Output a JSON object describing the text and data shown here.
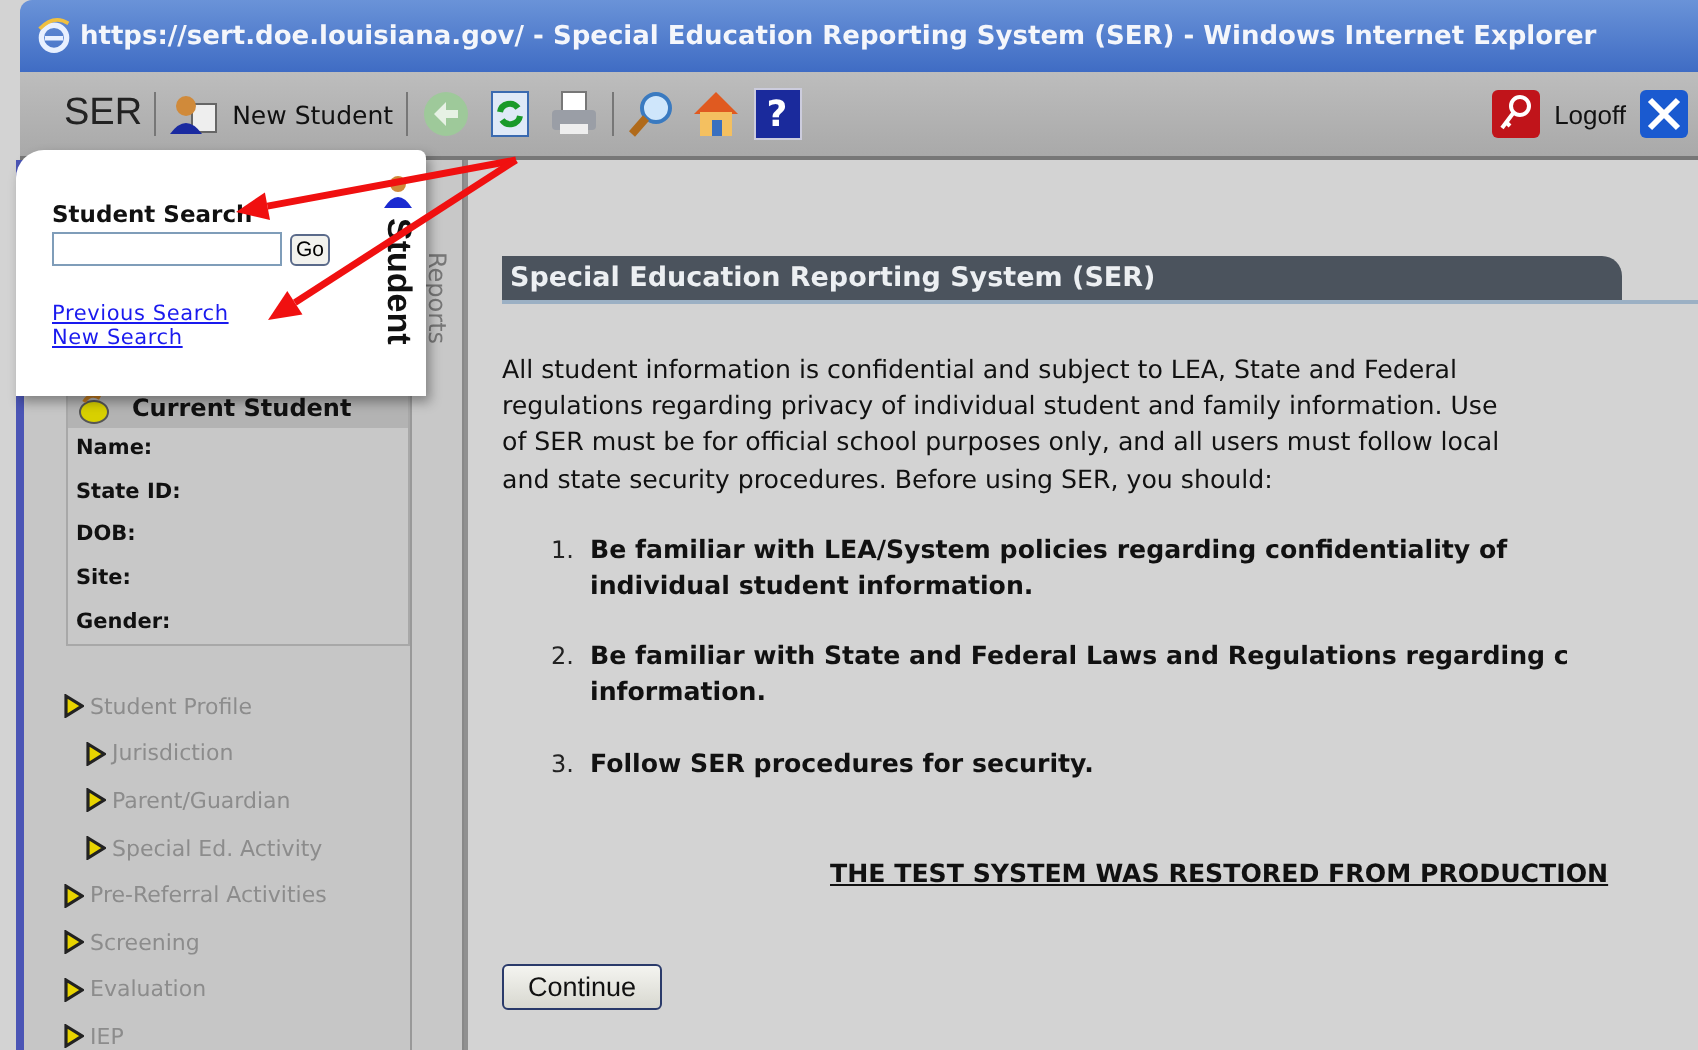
{
  "window": {
    "title": "https://sert.doe.louisiana.gov/ - Special Education Reporting System (SER) - Windows Internet Explorer"
  },
  "toolbar": {
    "logo": "SER",
    "new_student": "New Student",
    "help": "?",
    "logoff": "Logoff"
  },
  "search_flyout": {
    "title": "Student Search",
    "go": "Go",
    "links": [
      "Previous Search",
      "New Search"
    ],
    "tab": "Student"
  },
  "side_tab": "Reports",
  "current_student": {
    "title": "Current Student",
    "fields": [
      "Name:",
      "State ID:",
      "DOB:",
      "Site:",
      "Gender:"
    ]
  },
  "nav": [
    {
      "label": "Student Profile",
      "disabled": true,
      "children": [
        {
          "label": "Jurisdiction",
          "disabled": true
        },
        {
          "label": "Parent/Guardian",
          "disabled": true
        },
        {
          "label": "Special Ed. Activity",
          "disabled": true
        }
      ]
    },
    {
      "label": "Pre-Referral Activities",
      "disabled": true
    },
    {
      "label": "Screening",
      "disabled": true
    },
    {
      "label": "Evaluation",
      "disabled": true
    },
    {
      "label": "IEP",
      "disabled": true
    }
  ],
  "content": {
    "heading": "Special Education Reporting System (SER)",
    "intro_lines": [
      "All student information is confidential and subject to LEA, State and Federal",
      "regulations regarding privacy of individual student and family information. Use",
      "of SER must be for official school purposes only, and all users must follow local",
      "and state security procedures. Before using SER, you should:"
    ],
    "steps": [
      {
        "number": "1.",
        "lines": [
          "Be familiar with LEA/System policies regarding confidentiality of",
          "individual student information."
        ]
      },
      {
        "number": "2.",
        "lines": [
          "Be familiar with State and Federal Laws and Regulations regarding c",
          "information."
        ]
      },
      {
        "number": "3.",
        "lines": [
          "Follow SER procedures for security."
        ]
      }
    ],
    "notice": "THE TEST SYSTEM WAS RESTORED FROM PRODUCTION",
    "continue": "Continue"
  }
}
